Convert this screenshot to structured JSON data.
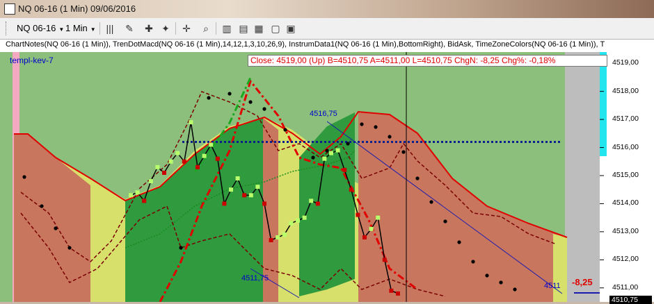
{
  "window": {
    "title": "NQ 06-16 (1 Min)  09/06/2016"
  },
  "toolbar": {
    "instrument": "NQ 06-16",
    "interval": "1 Min",
    "icons": [
      "bar-style-icon",
      "pencil-icon",
      "add-indicator-icon",
      "remove-indicator-icon",
      "crosshair-icon",
      "zoom-icon",
      "chart-trader-icon",
      "data-box-icon",
      "chart-properties-icon",
      "templates-icon",
      "properties-icon"
    ]
  },
  "chart": {
    "info_line": "ChartNotes(NQ 06-16 (1 Min)), TrenDotMacd(NQ 06-16 (1 Min),14,12,1,3,10,26,9), InstrumData1(NQ 06-16 (1 Min),BottomRight), BidAsk, TimeZoneColors(NQ 06-16 (1 Min)), T",
    "template_label": "templ-kev-7",
    "data_box": "Close:  4519,00  (Up)    B=4510,75  A=4511,00  L=4510,75  ChgN:  -8,25  Chg%:  -0,18%",
    "annotations": [
      "4516,75",
      "4511,75",
      "4511"
    ],
    "change_value": "-8,25",
    "last_price": "4510,75",
    "colors": {
      "green_zone": "#8cbf7c",
      "dark_green": "#2f9a3e",
      "red_zone": "#c8775e",
      "yellow_zone": "#d6e06a",
      "dotted_line": "#0b1f8c"
    }
  },
  "chart_data": {
    "type": "line",
    "ylabel": "",
    "y_ticks": [
      "4519,00",
      "4518,00",
      "4517,00",
      "4516,00",
      "4515,00",
      "4514,00",
      "4513,00",
      "4512,00",
      "4511,00"
    ],
    "ylim": [
      4510.5,
      4519.4
    ],
    "horizontal_line": 4516.2,
    "close_series": [
      4514.3,
      4514.4,
      4514.1,
      4514.8,
      4515.3,
      4515.1,
      4515.5,
      4515.8,
      4515.5,
      4516.9,
      4515.3,
      4515.7,
      4516.1,
      4515.6,
      4514.0,
      4514.5,
      4514.9,
      4514.3,
      4514.3,
      4514.6,
      4514.0,
      4512.7,
      4512.8,
      4512.9,
      4513.3,
      4513.4,
      4513.5,
      4514.1,
      4514.0,
      4515.6,
      4515.8,
      4515.9,
      4515.2,
      4514.5,
      4513.6,
      4512.8,
      4513.1,
      4513.5,
      4512.0,
      4510.9,
      4510.8
    ]
  }
}
